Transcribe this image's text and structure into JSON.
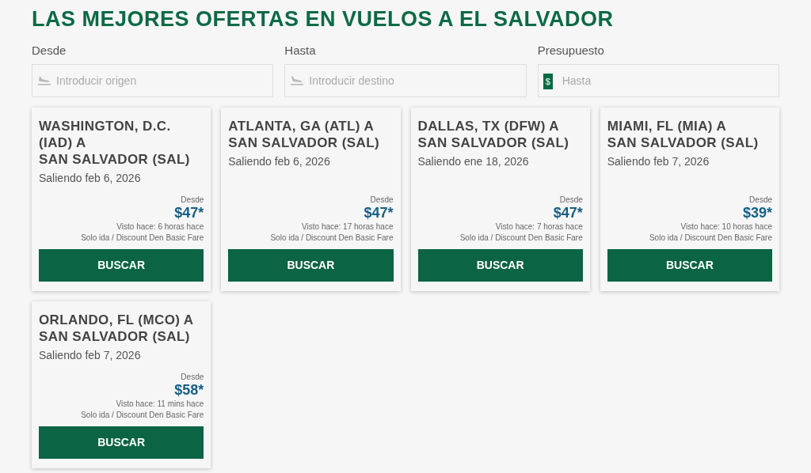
{
  "heading": "LAS MEJORES OFERTAS EN VUELOS A EL SALVADOR",
  "filters": [
    {
      "label": "Desde",
      "placeholder": "Introducir origen",
      "kind": "departure"
    },
    {
      "label": "Hasta",
      "placeholder": "Introducir destino",
      "kind": "arrival"
    },
    {
      "label": "Presupuesto",
      "placeholder": "Hasta",
      "kind": "budget",
      "badge": "$"
    }
  ],
  "deals": [
    {
      "route_from": "WASHINGTON, D.C. (IAD) A",
      "route_to": "SAN SALVADOR (SAL)",
      "date": "Saliendo feb 6, 2026",
      "from_label": "Desde",
      "price": "$47*",
      "seen": "Visto hace: 6 horas hace",
      "fare": "Solo ida / Discount Den Basic Fare",
      "button": "BUSCAR"
    },
    {
      "route_from": "ATLANTA, GA (ATL) A",
      "route_to": "SAN SALVADOR (SAL)",
      "date": "Saliendo feb 6, 2026",
      "from_label": "Desde",
      "price": "$47*",
      "seen": "Visto hace: 17 horas hace",
      "fare": "Solo ida / Discount Den Basic Fare",
      "button": "BUSCAR"
    },
    {
      "route_from": "DALLAS, TX (DFW) A",
      "route_to": "SAN SALVADOR (SAL)",
      "date": "Saliendo ene 18, 2026",
      "from_label": "Desde",
      "price": "$47*",
      "seen": "Visto hace: 7 horas hace",
      "fare": "Solo ida / Discount Den Basic Fare",
      "button": "BUSCAR"
    },
    {
      "route_from": "MIAMI, FL (MIA) A",
      "route_to": "SAN SALVADOR (SAL)",
      "date": "Saliendo feb 7, 2026",
      "from_label": "Desde",
      "price": "$39*",
      "seen": "Visto hace: 10 horas hace",
      "fare": "Solo ida / Discount Den Basic Fare",
      "button": "BUSCAR"
    },
    {
      "route_from": "ORLANDO, FL (MCO) A",
      "route_to": "SAN SALVADOR (SAL)",
      "date": "Saliendo feb 7, 2026",
      "from_label": "Desde",
      "price": "$58*",
      "seen": "Visto hace: 11 mins hace",
      "fare": "Solo ida / Discount Den Basic Fare",
      "button": "BUSCAR"
    }
  ]
}
